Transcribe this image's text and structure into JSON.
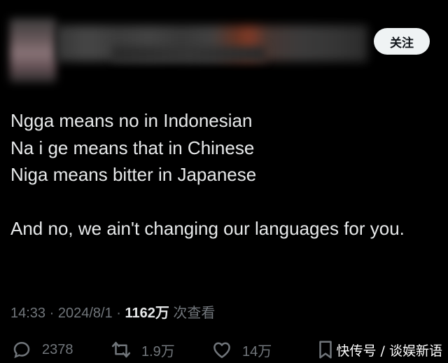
{
  "header": {
    "follow_label": "关注"
  },
  "tweet": {
    "lines": [
      "Ngga means no in Indonesian",
      "Na i ge means that in Chinese",
      "Niga means bitter in Japanese"
    ],
    "closing": "And no, we ain't changing our languages for you."
  },
  "meta": {
    "time": "14:33",
    "sep1": " · ",
    "date": "2024/8/1",
    "sep2": " · ",
    "views": "1162万",
    "views_suffix": " 次查看"
  },
  "actions": {
    "reply_count": "2378",
    "retweet_count": "1.9万",
    "like_count": "14万",
    "reply_icon": "reply-icon",
    "retweet_icon": "retweet-icon",
    "like_icon": "heart-icon",
    "bookmark_icon": "bookmark-icon"
  },
  "watermark": "快传号 / 谈娱新语",
  "colors": {
    "background": "#000000",
    "text": "#e7e9ea",
    "secondary": "#71767b",
    "follow_bg": "#eff3f4"
  }
}
